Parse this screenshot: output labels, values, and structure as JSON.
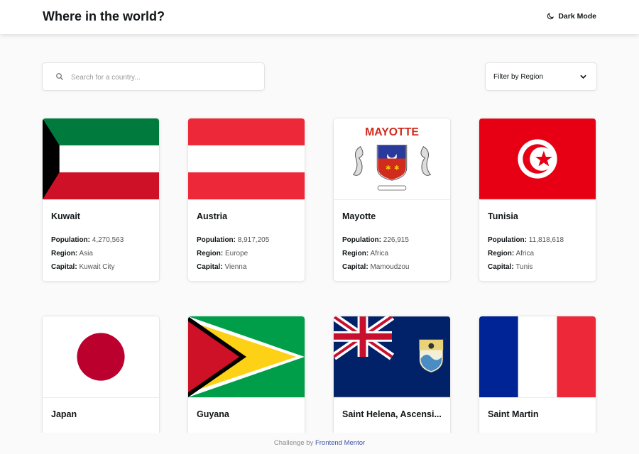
{
  "header": {
    "title": "Where in the world?",
    "theme_toggle": "Dark Mode"
  },
  "search": {
    "placeholder": "Search for a country..."
  },
  "filter": {
    "label": "Filter by Region"
  },
  "labels": {
    "population": "Population:",
    "region": "Region:",
    "capital": "Capital:"
  },
  "countries": [
    {
      "name": "Kuwait",
      "population": "4,270,563",
      "region": "Asia",
      "capital": "Kuwait City"
    },
    {
      "name": "Austria",
      "population": "8,917,205",
      "region": "Europe",
      "capital": "Vienna"
    },
    {
      "name": "Mayotte",
      "population": "226,915",
      "region": "Africa",
      "capital": "Mamoudzou",
      "flag_text": "MAYOTTE"
    },
    {
      "name": "Tunisia",
      "population": "11,818,618",
      "region": "Africa",
      "capital": "Tunis"
    },
    {
      "name": "Japan"
    },
    {
      "name": "Guyana"
    },
    {
      "name": "Saint Helena, Ascensi..."
    },
    {
      "name": "Saint Martin"
    }
  ],
  "footer": {
    "text": "Challenge by",
    "link": "Frontend Mentor"
  },
  "colors": {
    "background": "#fafafa",
    "card": "#ffffff",
    "text": "#111517",
    "link": "#3e52a3"
  }
}
